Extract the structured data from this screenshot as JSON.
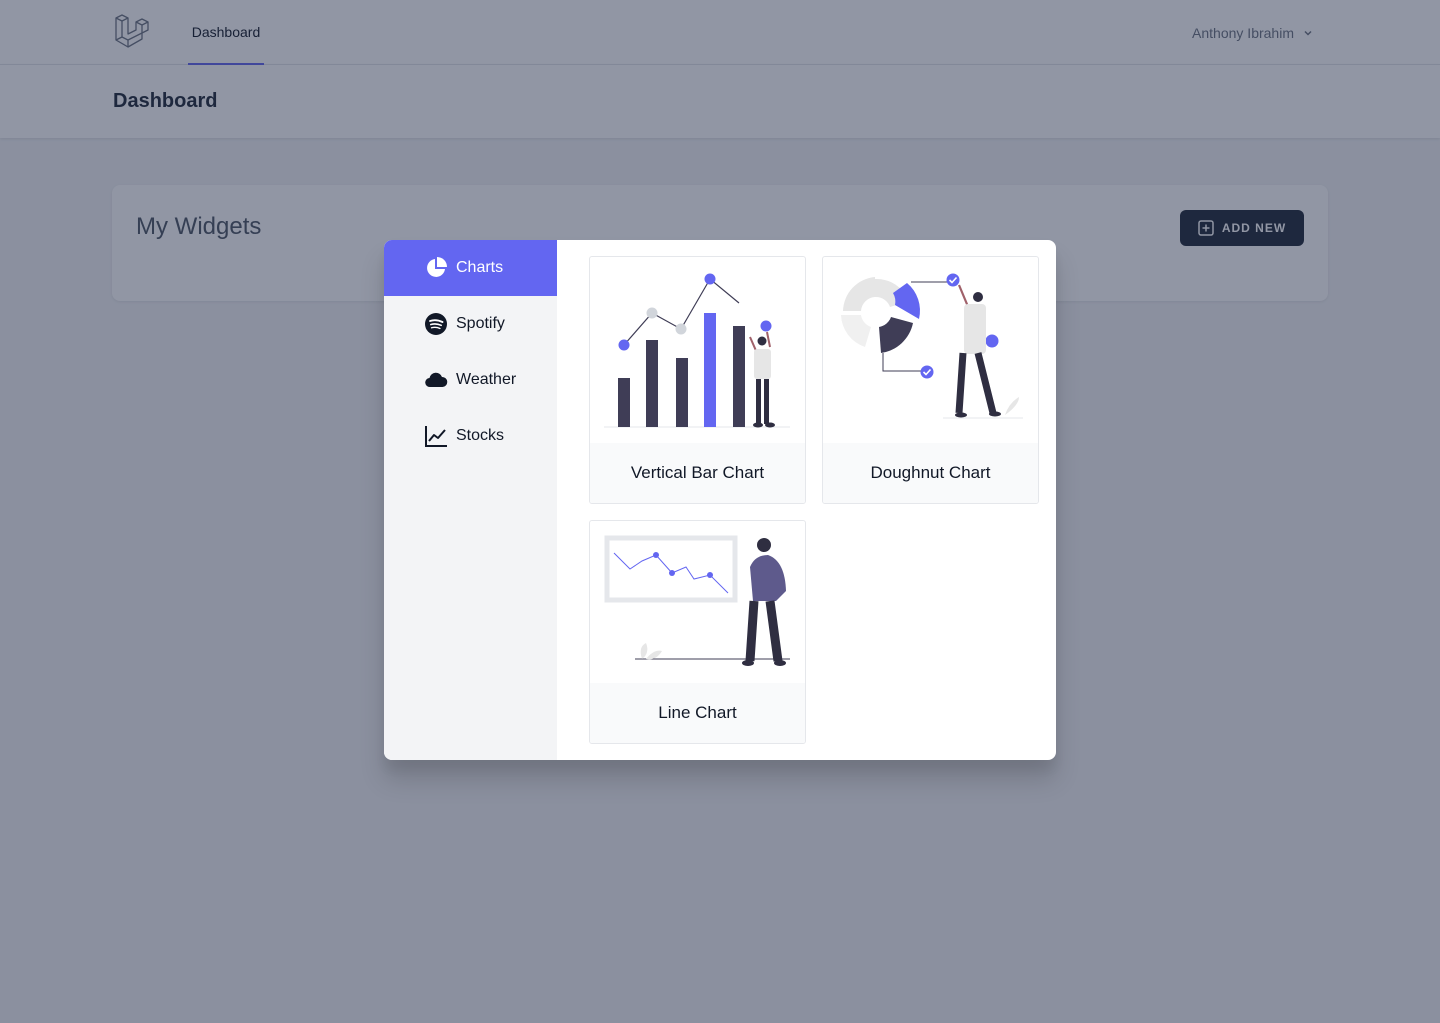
{
  "nav": {
    "logo_icon": "laravel-logo-icon",
    "links": [
      {
        "label": "Dashboard",
        "active": true
      }
    ],
    "user_name": "Anthony Ibrahim",
    "user_menu_icon": "chevron-down-icon"
  },
  "header": {
    "title": "Dashboard"
  },
  "widgets": {
    "title": "My Widgets",
    "add_new_label": "ADD NEW",
    "add_new_icon": "plus-square-icon"
  },
  "modal": {
    "categories": [
      {
        "label": "Charts",
        "icon": "pie-chart-icon",
        "active": true
      },
      {
        "label": "Spotify",
        "icon": "spotify-icon",
        "active": false
      },
      {
        "label": "Weather",
        "icon": "cloud-icon",
        "active": false
      },
      {
        "label": "Stocks",
        "icon": "line-chart-icon",
        "active": false
      }
    ],
    "widgets": [
      {
        "label": "Vertical Bar Chart",
        "illustration": "bar-chart-illustration"
      },
      {
        "label": "Doughnut Chart",
        "illustration": "doughnut-chart-illustration"
      },
      {
        "label": "Line Chart",
        "illustration": "line-chart-illustration"
      }
    ]
  },
  "colors": {
    "accent": "#6366f1",
    "dark": "#3f3d56",
    "overlay": "#1f2945"
  }
}
